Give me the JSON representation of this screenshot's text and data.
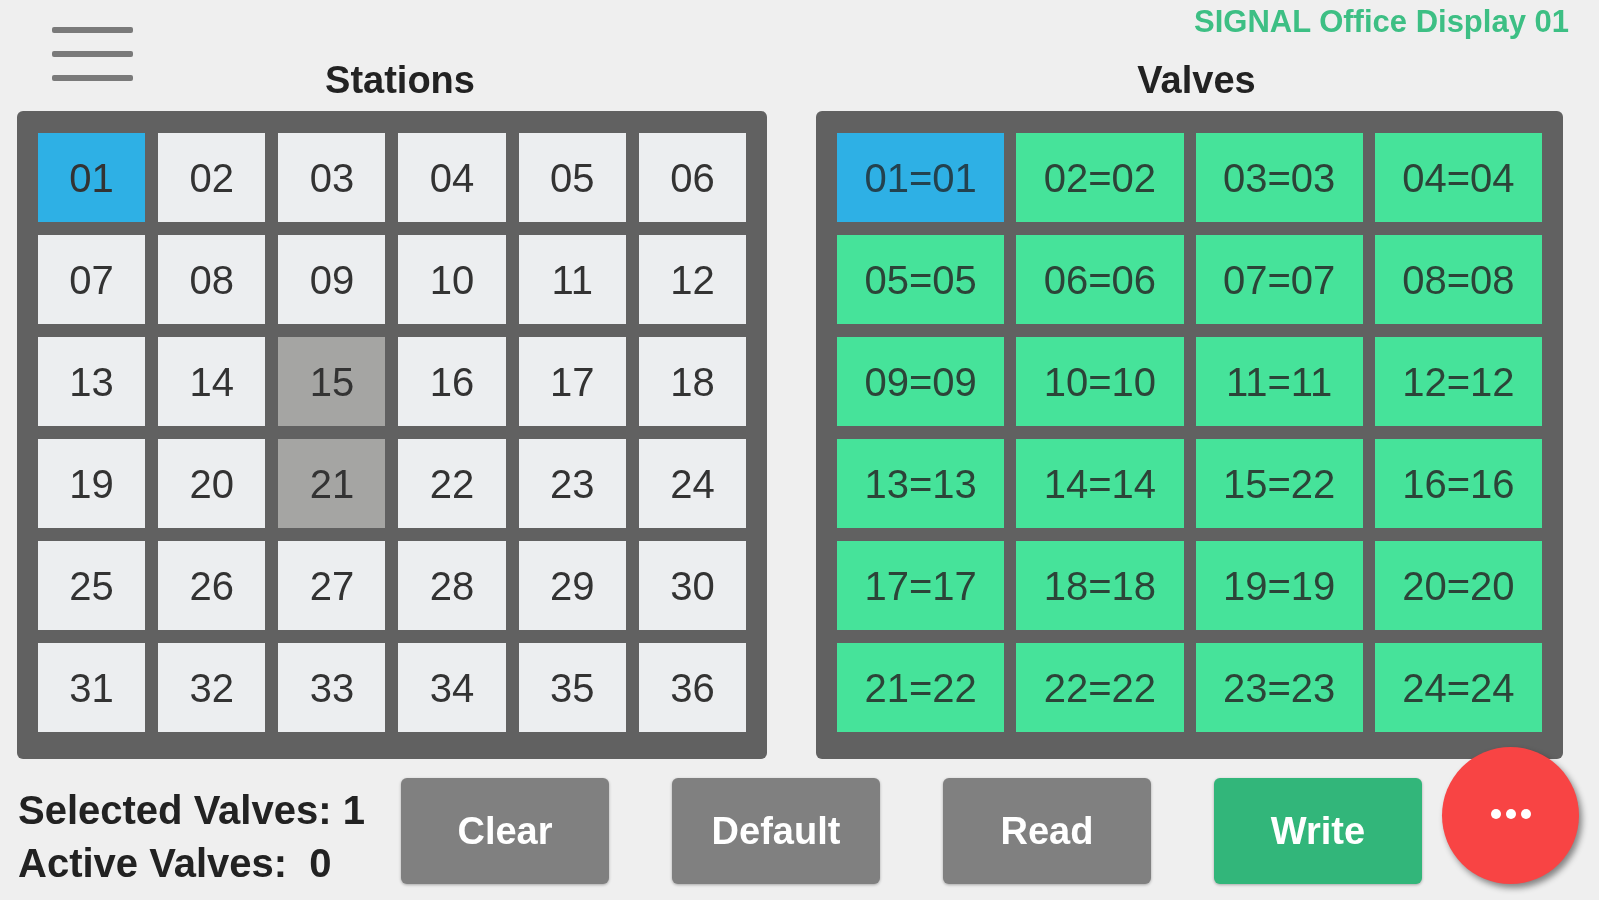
{
  "header": {
    "title": "SIGNAL Office Display 01"
  },
  "stations": {
    "title": "Stations",
    "items": [
      {
        "label": "01",
        "selected": true,
        "disabled": false
      },
      {
        "label": "02",
        "selected": false,
        "disabled": false
      },
      {
        "label": "03",
        "selected": false,
        "disabled": false
      },
      {
        "label": "04",
        "selected": false,
        "disabled": false
      },
      {
        "label": "05",
        "selected": false,
        "disabled": false
      },
      {
        "label": "06",
        "selected": false,
        "disabled": false
      },
      {
        "label": "07",
        "selected": false,
        "disabled": false
      },
      {
        "label": "08",
        "selected": false,
        "disabled": false
      },
      {
        "label": "09",
        "selected": false,
        "disabled": false
      },
      {
        "label": "10",
        "selected": false,
        "disabled": false
      },
      {
        "label": "11",
        "selected": false,
        "disabled": false
      },
      {
        "label": "12",
        "selected": false,
        "disabled": false
      },
      {
        "label": "13",
        "selected": false,
        "disabled": false
      },
      {
        "label": "14",
        "selected": false,
        "disabled": false
      },
      {
        "label": "15",
        "selected": false,
        "disabled": true
      },
      {
        "label": "16",
        "selected": false,
        "disabled": false
      },
      {
        "label": "17",
        "selected": false,
        "disabled": false
      },
      {
        "label": "18",
        "selected": false,
        "disabled": false
      },
      {
        "label": "19",
        "selected": false,
        "disabled": false
      },
      {
        "label": "20",
        "selected": false,
        "disabled": false
      },
      {
        "label": "21",
        "selected": false,
        "disabled": true
      },
      {
        "label": "22",
        "selected": false,
        "disabled": false
      },
      {
        "label": "23",
        "selected": false,
        "disabled": false
      },
      {
        "label": "24",
        "selected": false,
        "disabled": false
      },
      {
        "label": "25",
        "selected": false,
        "disabled": false
      },
      {
        "label": "26",
        "selected": false,
        "disabled": false
      },
      {
        "label": "27",
        "selected": false,
        "disabled": false
      },
      {
        "label": "28",
        "selected": false,
        "disabled": false
      },
      {
        "label": "29",
        "selected": false,
        "disabled": false
      },
      {
        "label": "30",
        "selected": false,
        "disabled": false
      },
      {
        "label": "31",
        "selected": false,
        "disabled": false
      },
      {
        "label": "32",
        "selected": false,
        "disabled": false
      },
      {
        "label": "33",
        "selected": false,
        "disabled": false
      },
      {
        "label": "34",
        "selected": false,
        "disabled": false
      },
      {
        "label": "35",
        "selected": false,
        "disabled": false
      },
      {
        "label": "36",
        "selected": false,
        "disabled": false
      }
    ]
  },
  "valves": {
    "title": "Valves",
    "items": [
      {
        "label": "01=01",
        "selected": true
      },
      {
        "label": "02=02",
        "selected": false
      },
      {
        "label": "03=03",
        "selected": false
      },
      {
        "label": "04=04",
        "selected": false
      },
      {
        "label": "05=05",
        "selected": false
      },
      {
        "label": "06=06",
        "selected": false
      },
      {
        "label": "07=07",
        "selected": false
      },
      {
        "label": "08=08",
        "selected": false
      },
      {
        "label": "09=09",
        "selected": false
      },
      {
        "label": "10=10",
        "selected": false
      },
      {
        "label": "11=11",
        "selected": false
      },
      {
        "label": "12=12",
        "selected": false
      },
      {
        "label": "13=13",
        "selected": false
      },
      {
        "label": "14=14",
        "selected": false
      },
      {
        "label": "15=22",
        "selected": false
      },
      {
        "label": "16=16",
        "selected": false
      },
      {
        "label": "17=17",
        "selected": false
      },
      {
        "label": "18=18",
        "selected": false
      },
      {
        "label": "19=19",
        "selected": false
      },
      {
        "label": "20=20",
        "selected": false
      },
      {
        "label": "21=22",
        "selected": false
      },
      {
        "label": "22=22",
        "selected": false
      },
      {
        "label": "23=23",
        "selected": false
      },
      {
        "label": "24=24",
        "selected": false
      }
    ]
  },
  "status": [
    "Selected Valves: 1",
    "Active Valves:  0"
  ],
  "buttons": [
    {
      "label": "Clear",
      "kind": "neutral"
    },
    {
      "label": "Default",
      "kind": "neutral"
    },
    {
      "label": "Read",
      "kind": "neutral"
    },
    {
      "label": "Write",
      "kind": "primary"
    }
  ],
  "fab": {
    "kind": "more"
  }
}
